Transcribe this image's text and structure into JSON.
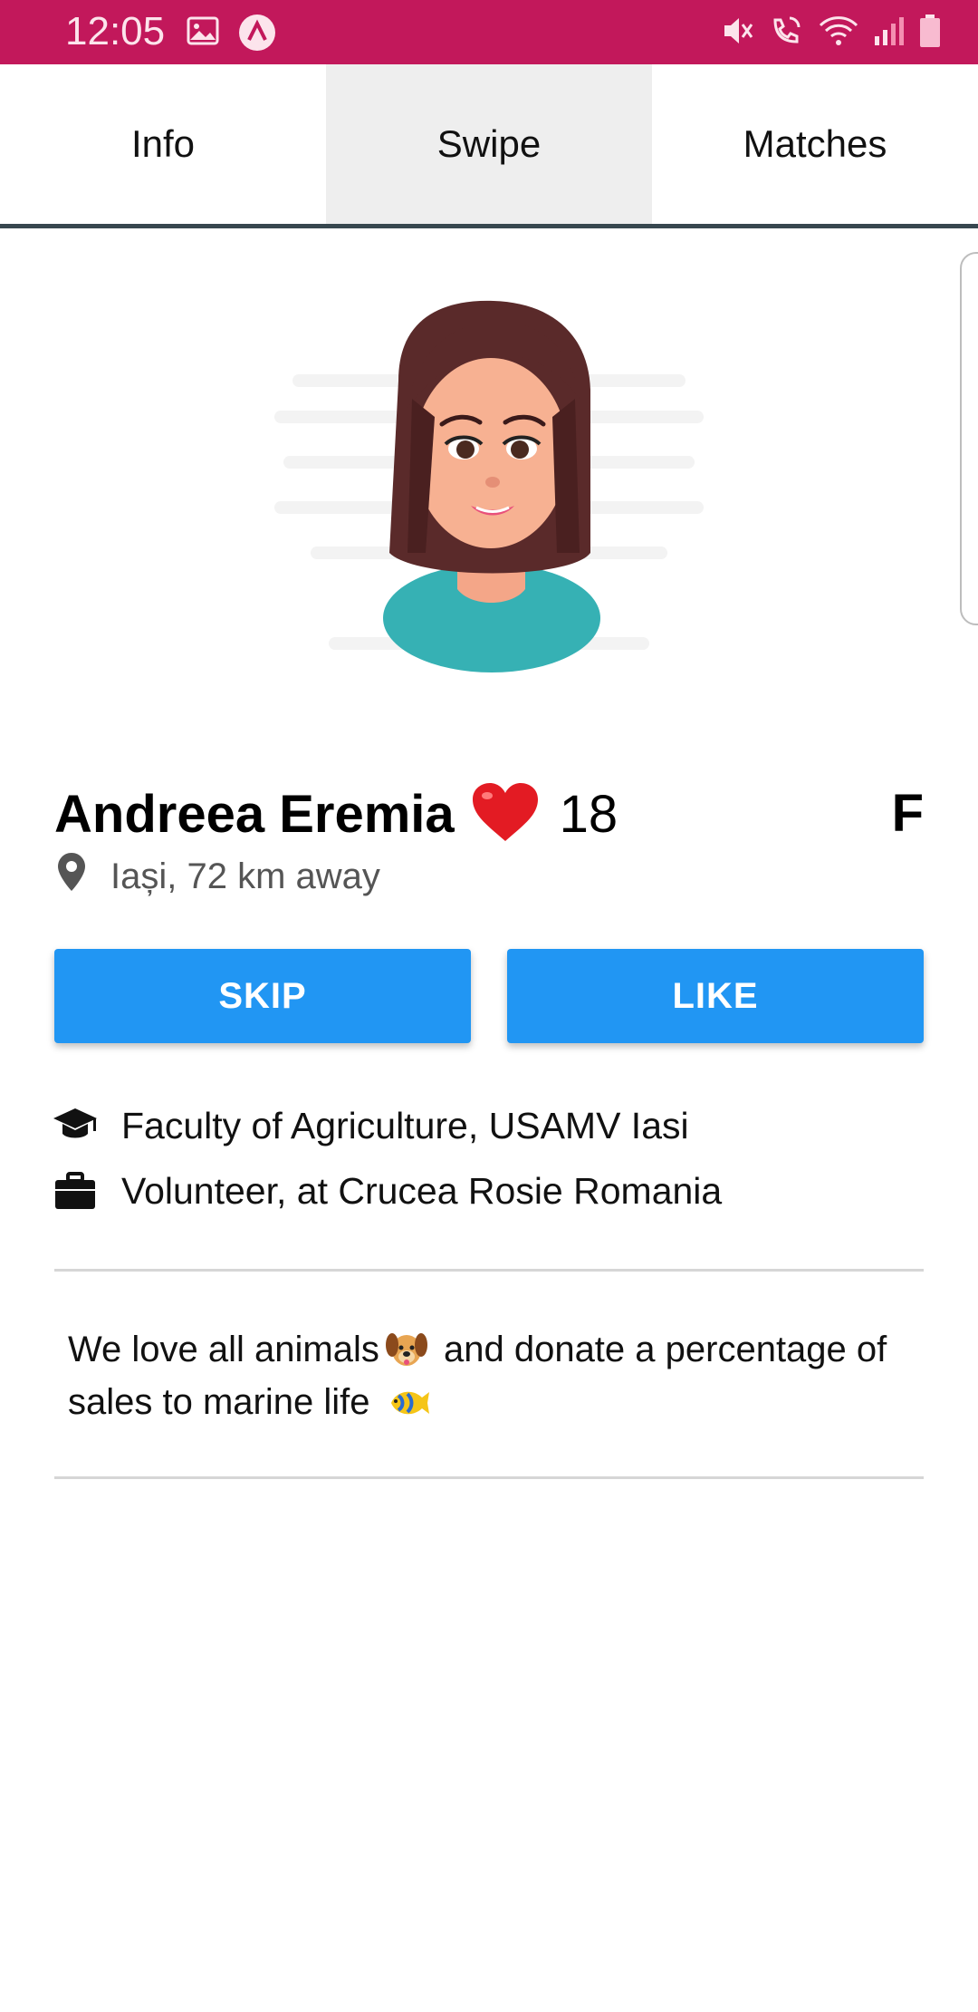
{
  "status_bar": {
    "time": "12:05",
    "left_icons": [
      "image-icon",
      "app-notification-icon"
    ],
    "right_icons": [
      "mute-icon",
      "wifi-calling-icon",
      "wifi-icon",
      "signal-icon",
      "battery-icon"
    ],
    "background": "#c2185b"
  },
  "tabs": [
    {
      "label": "Info",
      "active": false
    },
    {
      "label": "Swipe",
      "active": true
    },
    {
      "label": "Matches",
      "active": false
    }
  ],
  "profile": {
    "name": "Andreea Eremia",
    "age": "18",
    "gender": "F",
    "location": "Iași, 72 km away"
  },
  "buttons": {
    "skip": "SKIP",
    "like": "LIKE",
    "color": "#2196f3"
  },
  "details": {
    "education": "Faculty of Agriculture, USAMV Iasi",
    "work": "Volunteer, at Crucea Rosie Romania"
  },
  "bio": {
    "part1": "We love all animals",
    "part2": "and donate a percentage of sales to marine life"
  }
}
